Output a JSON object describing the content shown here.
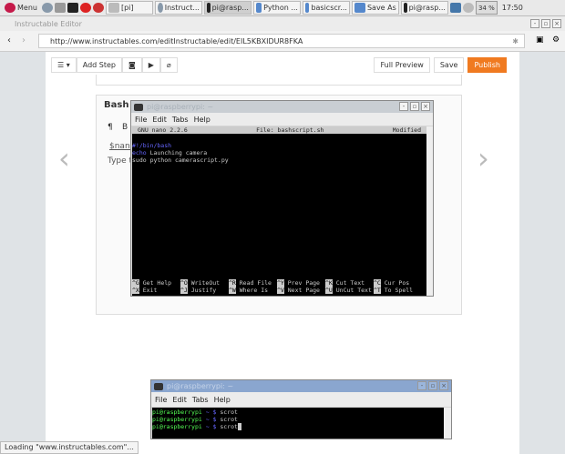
{
  "taskbar": {
    "menu": "Menu",
    "tasks": [
      "[pi]",
      "Instruct...",
      "pi@rasp...",
      "Python ...",
      "basicscr...",
      "Save As",
      "pi@rasp..."
    ],
    "battery": "34 %",
    "clock": "17:50"
  },
  "window": {
    "title": "Instructable Editor"
  },
  "browser": {
    "url": "http://www.instructables.com/editInstructable/edit/EIL5KBXIDUR8FKA",
    "status": "Loading \"www.instructables.com\"..."
  },
  "toolbar": {
    "add_step": "Add Step",
    "full_preview": "Full Preview",
    "save": "Save",
    "publish": "Publish",
    "publish_color": "#f07a20"
  },
  "editor": {
    "heading": "Bash s",
    "format_p": "¶",
    "format_b": "B",
    "line1": "$nano",
    "line2": "Type th"
  },
  "nano_window": {
    "title": "pi@raspberrypi: ~",
    "menu": [
      "File",
      "Edit",
      "Tabs",
      "Help"
    ],
    "header_left": "GNU nano 2.2.6",
    "header_center": "File: bashscript.sh",
    "header_right": "Modified",
    "lines": [
      "#!/bin/bash",
      "echo Launching camera",
      "sudo python camerascript.py"
    ],
    "shortcuts": [
      [
        "^G",
        "Get Help"
      ],
      [
        "^O",
        "WriteOut"
      ],
      [
        "^R",
        "Read File"
      ],
      [
        "^Y",
        "Prev Page"
      ],
      [
        "^K",
        "Cut Text"
      ],
      [
        "^C",
        "Cur Pos"
      ],
      [
        "^X",
        "Exit"
      ],
      [
        "^J",
        "Justify"
      ],
      [
        "^W",
        "Where Is"
      ],
      [
        "^V",
        "Next Page"
      ],
      [
        "^U",
        "UnCut Text"
      ],
      [
        "^T",
        "To Spell"
      ]
    ]
  },
  "term_window": {
    "title": "pi@raspberrypi: ~",
    "menu": [
      "File",
      "Edit",
      "Tabs",
      "Help"
    ],
    "prompt": "pi@raspberrypi",
    "sep": "~ $",
    "cmds": [
      "scrot",
      "scrot",
      "scrot"
    ]
  }
}
